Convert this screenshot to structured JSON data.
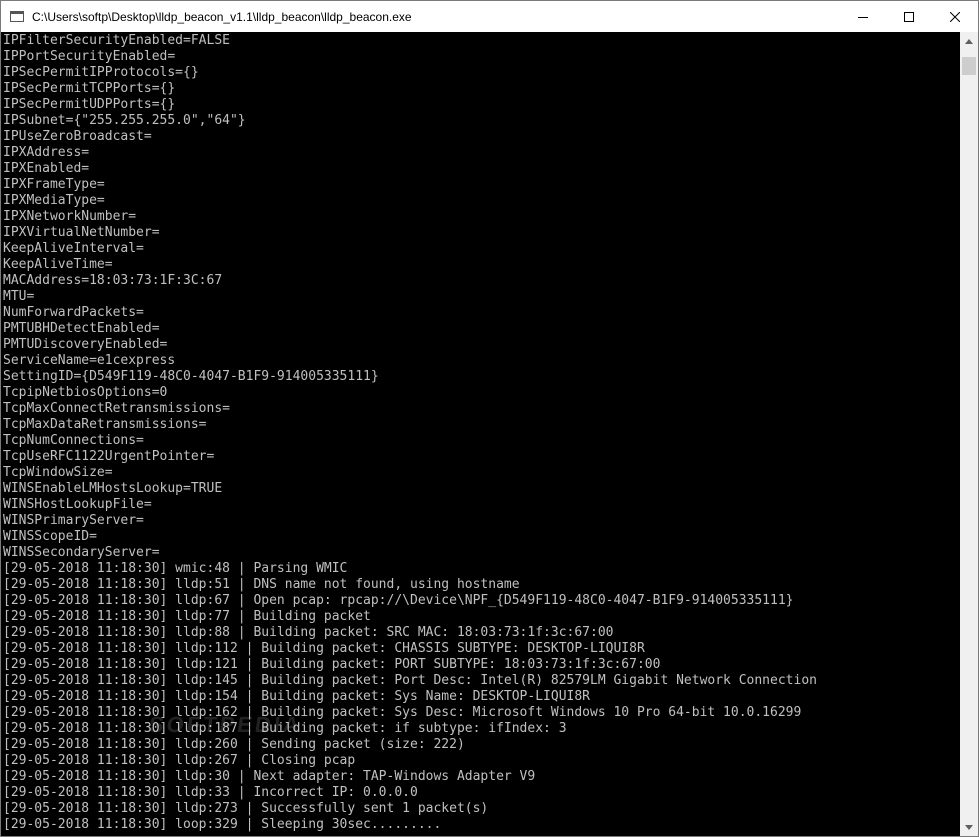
{
  "window": {
    "title": "C:\\Users\\softp\\Desktop\\lldp_beacon_v1.1\\lldp_beacon\\lldp_beacon.exe",
    "icon": "console-app-icon",
    "controls": [
      "minimize-icon",
      "maximize-icon",
      "close-icon"
    ]
  },
  "console": {
    "background": "#000000",
    "text_color": "#c0c0c0",
    "lines": [
      "IPFilterSecurityEnabled=FALSE",
      "IPPortSecurityEnabled=",
      "IPSecPermitIPProtocols={}",
      "IPSecPermitTCPPorts={}",
      "IPSecPermitUDPPorts={}",
      "IPSubnet={\"255.255.255.0\",\"64\"}",
      "IPUseZeroBroadcast=",
      "IPXAddress=",
      "IPXEnabled=",
      "IPXFrameType=",
      "IPXMediaType=",
      "IPXNetworkNumber=",
      "IPXVirtualNetNumber=",
      "KeepAliveInterval=",
      "KeepAliveTime=",
      "MACAddress=18:03:73:1F:3C:67",
      "MTU=",
      "NumForwardPackets=",
      "PMTUBHDetectEnabled=",
      "PMTUDiscoveryEnabled=",
      "ServiceName=e1cexpress",
      "SettingID={D549F119-48C0-4047-B1F9-914005335111}",
      "TcpipNetbiosOptions=0",
      "TcpMaxConnectRetransmissions=",
      "TcpMaxDataRetransmissions=",
      "TcpNumConnections=",
      "TcpUseRFC1122UrgentPointer=",
      "TcpWindowSize=",
      "WINSEnableLMHostsLookup=TRUE",
      "WINSHostLookupFile=",
      "WINSPrimaryServer=",
      "WINSScopeID=",
      "WINSSecondaryServer=",
      "[29-05-2018 11:18:30] wmic:48 | Parsing WMIC",
      "[29-05-2018 11:18:30] lldp:51 | DNS name not found, using hostname",
      "[29-05-2018 11:18:30] lldp:67 | Open pcap: rpcap://\\Device\\NPF_{D549F119-48C0-4047-B1F9-914005335111}",
      "[29-05-2018 11:18:30] lldp:77 | Building packet",
      "[29-05-2018 11:18:30] lldp:88 | Building packet: SRC MAC: 18:03:73:1f:3c:67:00",
      "[29-05-2018 11:18:30] lldp:112 | Building packet: CHASSIS SUBTYPE: DESKTOP-LIQUI8R",
      "[29-05-2018 11:18:30] lldp:121 | Building packet: PORT SUBTYPE: 18:03:73:1f:3c:67:00",
      "[29-05-2018 11:18:30] lldp:145 | Building packet: Port Desc: Intel(R) 82579LM Gigabit Network Connection",
      "[29-05-2018 11:18:30] lldp:154 | Building packet: Sys Name: DESKTOP-LIQUI8R",
      "[29-05-2018 11:18:30] lldp:162 | Building packet: Sys Desc: Microsoft Windows 10 Pro 64-bit 10.0.16299",
      "[29-05-2018 11:18:30] lldp:187 | Building packet: if subtype: ifIndex: 3",
      "[29-05-2018 11:18:30] lldp:260 | Sending packet (size: 222)",
      "[29-05-2018 11:18:30] lldp:267 | Closing pcap",
      "[29-05-2018 11:18:30] lldp:30 | Next adapter: TAP-Windows Adapter V9",
      "[29-05-2018 11:18:30] lldp:33 | Incorrect IP: 0.0.0.0",
      "[29-05-2018 11:18:30] lldp:273 | Successfully sent 1 packet(s)",
      "[29-05-2018 11:18:30] loop:329 | Sleeping 30sec........."
    ]
  },
  "watermark": "SOFTPEDIA",
  "scrollbar": {
    "icons": [
      "scroll-up-arrow-icon",
      "scroll-down-arrow-icon"
    ],
    "position_fraction": 0.0
  }
}
